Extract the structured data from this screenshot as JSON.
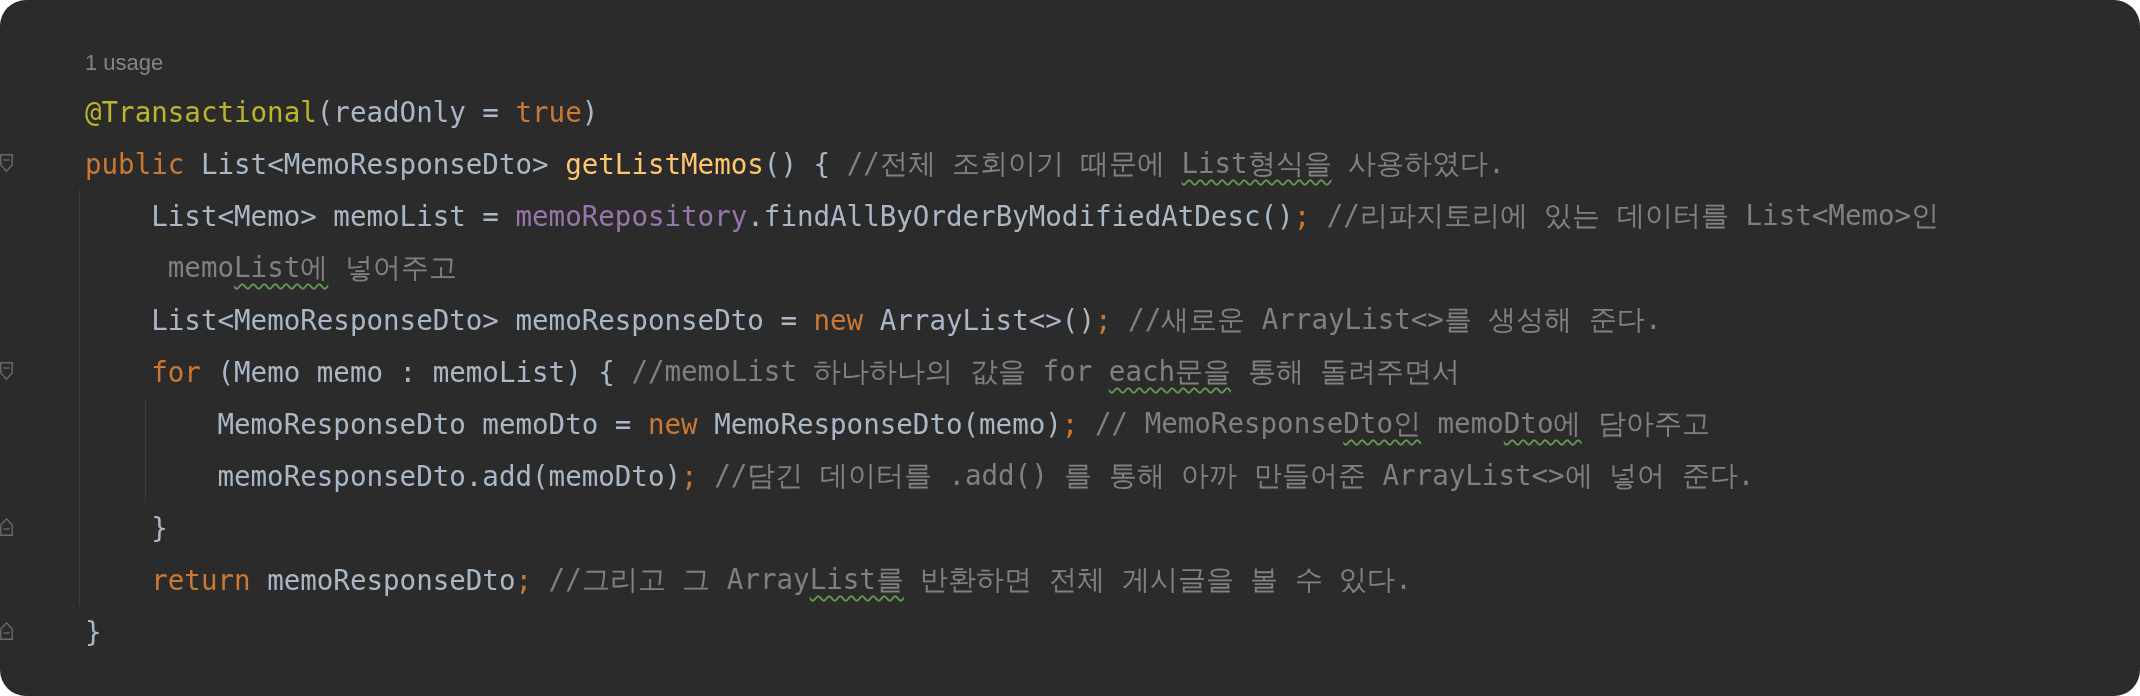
{
  "usage": "1 usage",
  "lines": [
    {
      "tokens": [
        {
          "kind": "annotation",
          "text": "@Transactional"
        },
        {
          "kind": "plain",
          "text": "(readOnly = "
        },
        {
          "kind": "keyword",
          "text": "true"
        },
        {
          "kind": "plain",
          "text": ")"
        }
      ]
    },
    {
      "fold_start": true,
      "tokens": [
        {
          "kind": "keyword",
          "text": "public"
        },
        {
          "kind": "plain",
          "text": " List<MemoResponseDto> "
        },
        {
          "kind": "method",
          "text": "getListMemos"
        },
        {
          "kind": "plain",
          "text": "() { "
        },
        {
          "kind": "comment",
          "segments": [
            {
              "text": "//전체 조회이기 때문에 "
            },
            {
              "text": "List형식을",
              "typo": true
            },
            {
              "text": " 사용하였다."
            }
          ]
        }
      ]
    },
    {
      "tokens": [
        {
          "kind": "plain",
          "text": "    List<Memo> memoList = "
        },
        {
          "kind": "field",
          "text": "memoRepository"
        },
        {
          "kind": "plain",
          "text": ".findAllByOrderByModifiedAtDesc()"
        },
        {
          "kind": "semicolon",
          "text": ";"
        },
        {
          "kind": "comment",
          "segments": [
            {
              "text": " //리파지토리에 있는 데이터를 List<Memo>인"
            }
          ]
        }
      ]
    },
    {
      "tokens": [
        {
          "kind": "comment",
          "segments": [
            {
              "text": "     memo"
            },
            {
              "text": "List에",
              "typo": true
            },
            {
              "text": " 넣어주고"
            }
          ]
        }
      ]
    },
    {
      "tokens": [
        {
          "kind": "plain",
          "text": "    List<MemoResponseDto> memoResponseDto = "
        },
        {
          "kind": "keyword",
          "text": "new"
        },
        {
          "kind": "plain",
          "text": " ArrayList<>()"
        },
        {
          "kind": "semicolon",
          "text": ";"
        },
        {
          "kind": "comment",
          "segments": [
            {
              "text": " //새로운 ArrayList<>를 생성해 준다."
            }
          ]
        }
      ]
    },
    {
      "fold_start": true,
      "tokens": [
        {
          "kind": "keyword",
          "text": "    for"
        },
        {
          "kind": "plain",
          "text": " (Memo memo : memoList) { "
        },
        {
          "kind": "comment",
          "segments": [
            {
              "text": "//memoList 하나하나의 값을 for "
            },
            {
              "text": "each문을",
              "typo": true
            },
            {
              "text": " 통해 돌려주면서"
            }
          ]
        }
      ]
    },
    {
      "tokens": [
        {
          "kind": "plain",
          "text": "        MemoResponseDto memoDto = "
        },
        {
          "kind": "keyword",
          "text": "new"
        },
        {
          "kind": "plain",
          "text": " MemoResponseDto(memo)"
        },
        {
          "kind": "semicolon",
          "text": ";"
        },
        {
          "kind": "comment",
          "segments": [
            {
              "text": " // MemoResponse"
            },
            {
              "text": "Dto인",
              "typo": true
            },
            {
              "text": " memo"
            },
            {
              "text": "Dto에",
              "typo": true
            },
            {
              "text": " 담아주고"
            }
          ]
        }
      ]
    },
    {
      "tokens": [
        {
          "kind": "plain",
          "text": "        memoResponseDto.add(memoDto)"
        },
        {
          "kind": "semicolon",
          "text": ";"
        },
        {
          "kind": "comment",
          "segments": [
            {
              "text": " //담긴 데이터를 .add() 를 통해 아까 만들어준 ArrayList<>에 넣어 준다."
            }
          ]
        }
      ]
    },
    {
      "fold_end": true,
      "tokens": [
        {
          "kind": "plain",
          "text": "    }"
        }
      ]
    },
    {
      "tokens": [
        {
          "kind": "keyword",
          "text": "    return"
        },
        {
          "kind": "plain",
          "text": " memoResponseDto"
        },
        {
          "kind": "semicolon",
          "text": ";"
        },
        {
          "kind": "comment",
          "segments": [
            {
              "text": " //그리고 그 Array"
            },
            {
              "text": "List를",
              "typo": true
            },
            {
              "text": " 반환하면 전체 게시글을 볼 수 있다."
            }
          ]
        }
      ]
    },
    {
      "fold_end": true,
      "tokens": [
        {
          "kind": "plain",
          "text": "}"
        }
      ]
    }
  ]
}
